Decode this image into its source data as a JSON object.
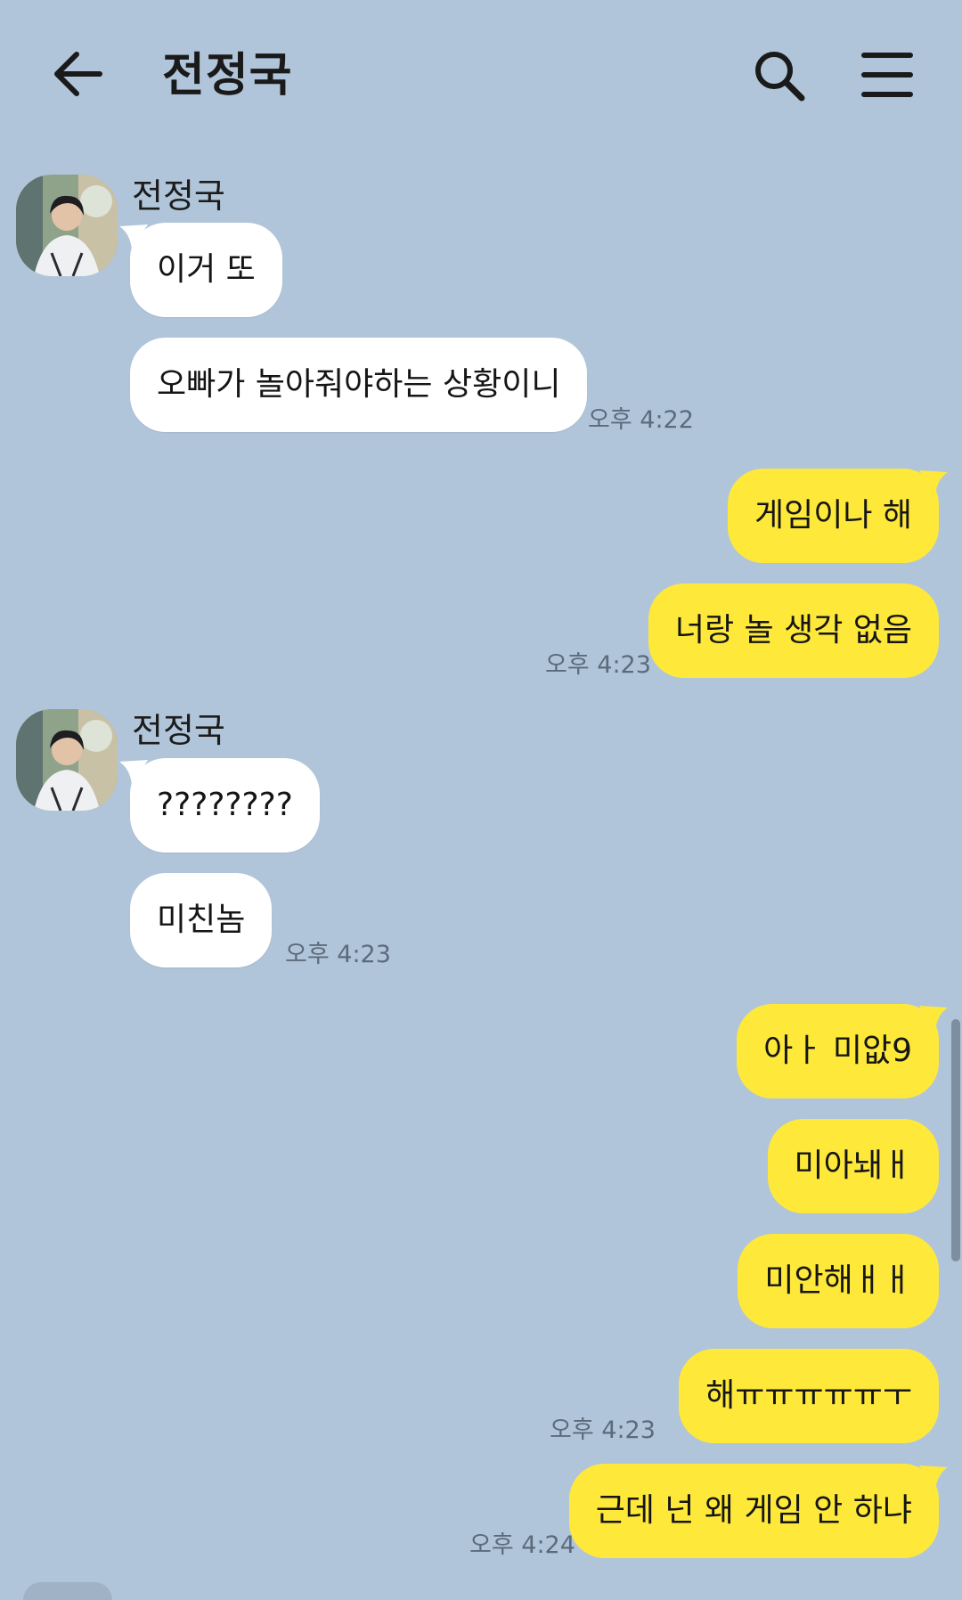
{
  "header": {
    "title": "전정국",
    "back_icon": "arrow-left-icon",
    "search_icon": "search-icon",
    "menu_icon": "hamburger-menu-icon"
  },
  "colors": {
    "background": "#b1c5da",
    "incoming_bubble": "#ffffff",
    "outgoing_bubble": "#fee93a",
    "timestamp": "#5b6b7c"
  },
  "messages": [
    {
      "side": "in",
      "sender": "전정국",
      "text": "이거 또"
    },
    {
      "side": "in",
      "text": "오빠가 놀아줘야하는 상황이니",
      "time": "오후 4:22"
    },
    {
      "side": "out",
      "text": "게임이나 해"
    },
    {
      "side": "out",
      "text": "너랑 놀 생각 없음",
      "time": "오후 4:23"
    },
    {
      "side": "in",
      "sender": "전정국",
      "text": "????????"
    },
    {
      "side": "in",
      "text": "미친놈",
      "time": "오후 4:23"
    },
    {
      "side": "out",
      "text": "아ㅏ 미앖9"
    },
    {
      "side": "out",
      "text": "미아놰ㅐ"
    },
    {
      "side": "out",
      "text": "미안해ㅐㅐ"
    },
    {
      "side": "out",
      "text": "해ㅠㅠㅠㅠㅠㅜ",
      "time": "오후 4:23"
    },
    {
      "side": "out",
      "text": "근데 넌 왜 게임 안 하냐",
      "time": "오후 4:24"
    }
  ]
}
